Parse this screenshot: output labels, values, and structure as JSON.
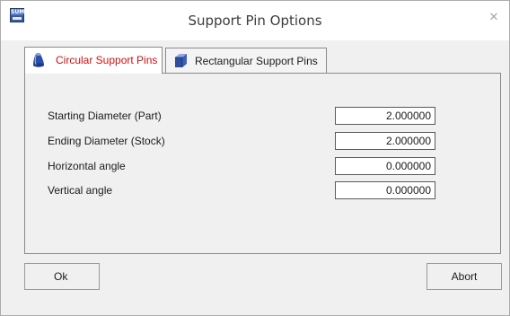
{
  "window": {
    "title": "Support Pin Options",
    "close_glyph": "✕",
    "app_icon": "sum-app-icon",
    "app_icon_text": "SUM"
  },
  "tabs": [
    {
      "label": "Circular Support Pins",
      "icon": "cylinder-icon",
      "active": true,
      "color": "#cc1111"
    },
    {
      "label": "Rectangular Support Pins",
      "icon": "box-icon",
      "active": false,
      "color": "#1b1b1b"
    }
  ],
  "fields": [
    {
      "label": "Starting Diameter (Part)",
      "value": "2.000000"
    },
    {
      "label": "Ending Diameter (Stock)",
      "value": "2.000000"
    },
    {
      "label": "Horizontal angle",
      "value": "0.000000"
    },
    {
      "label": "Vertical angle",
      "value": "0.000000"
    }
  ],
  "buttons": {
    "ok_label": "Ok",
    "abort_label": "Abort"
  }
}
